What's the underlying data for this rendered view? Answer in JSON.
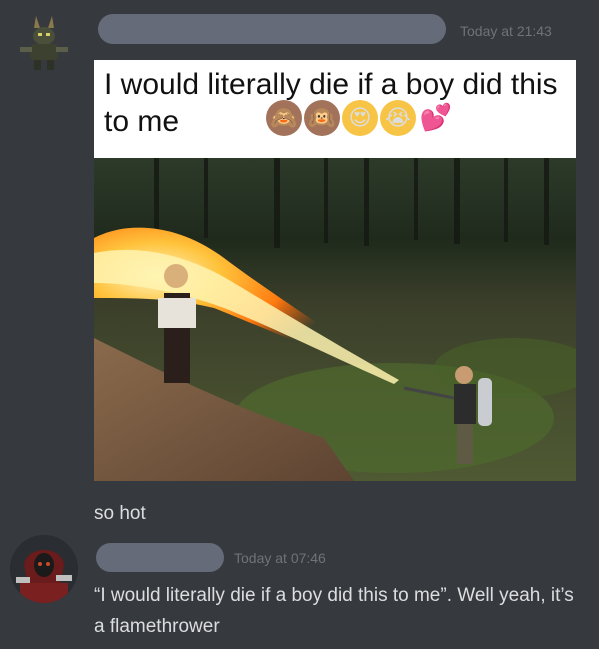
{
  "messages": [
    {
      "timestamp": "Today at 21:43",
      "meme_caption": "I would literally die if a boy did this to me",
      "emojis": [
        "see-no-evil-monkey-icon",
        "hear-no-evil-monkey-icon",
        "heart-eyes-icon",
        "crying-face-icon",
        "two-hearts-icon"
      ],
      "text": "so hot"
    },
    {
      "timestamp": "Today at 07:46",
      "text": "“I would literally die if a boy did this to me”. Well yeah, it’s a flamethrower"
    }
  ],
  "colors": {
    "background": "#36393e",
    "name_pill": "#656b78",
    "timestamp": "#6f737a",
    "text": "#dcddde"
  }
}
